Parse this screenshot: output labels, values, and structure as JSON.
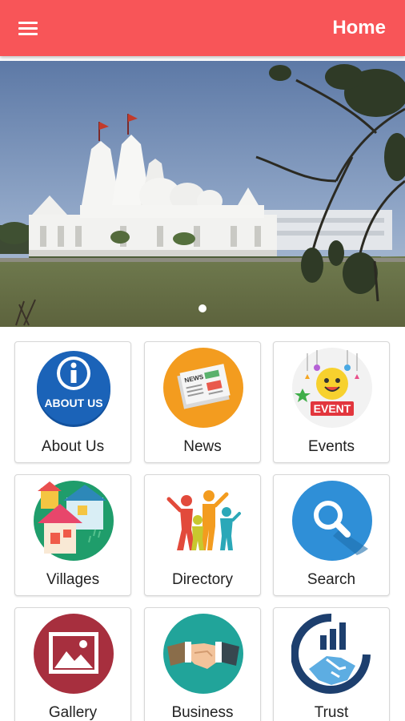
{
  "appbar": {
    "title": "Home",
    "color": "#f85558",
    "menu_icon": "hamburger-menu-icon"
  },
  "banner": {
    "image": "white marble temple with lawn and tree branch",
    "slides_total": 1,
    "active_slide": 1
  },
  "tiles": [
    {
      "label": "About Us",
      "icon": "about-us-info-icon",
      "badge_text": "ABOUT US"
    },
    {
      "label": "News",
      "icon": "newspaper-icon",
      "badge_text": "NEWS"
    },
    {
      "label": "Events",
      "icon": "event-smiley-icon",
      "badge_text": "EVENT"
    },
    {
      "label": "Villages",
      "icon": "village-houses-icon"
    },
    {
      "label": "Directory",
      "icon": "family-people-icon"
    },
    {
      "label": "Search",
      "icon": "magnifier-icon"
    },
    {
      "label": "Gallery",
      "icon": "picture-frame-icon"
    },
    {
      "label": "Business",
      "icon": "handshake-icon"
    },
    {
      "label": "Trust",
      "icon": "trust-handshake-chart-icon"
    }
  ]
}
